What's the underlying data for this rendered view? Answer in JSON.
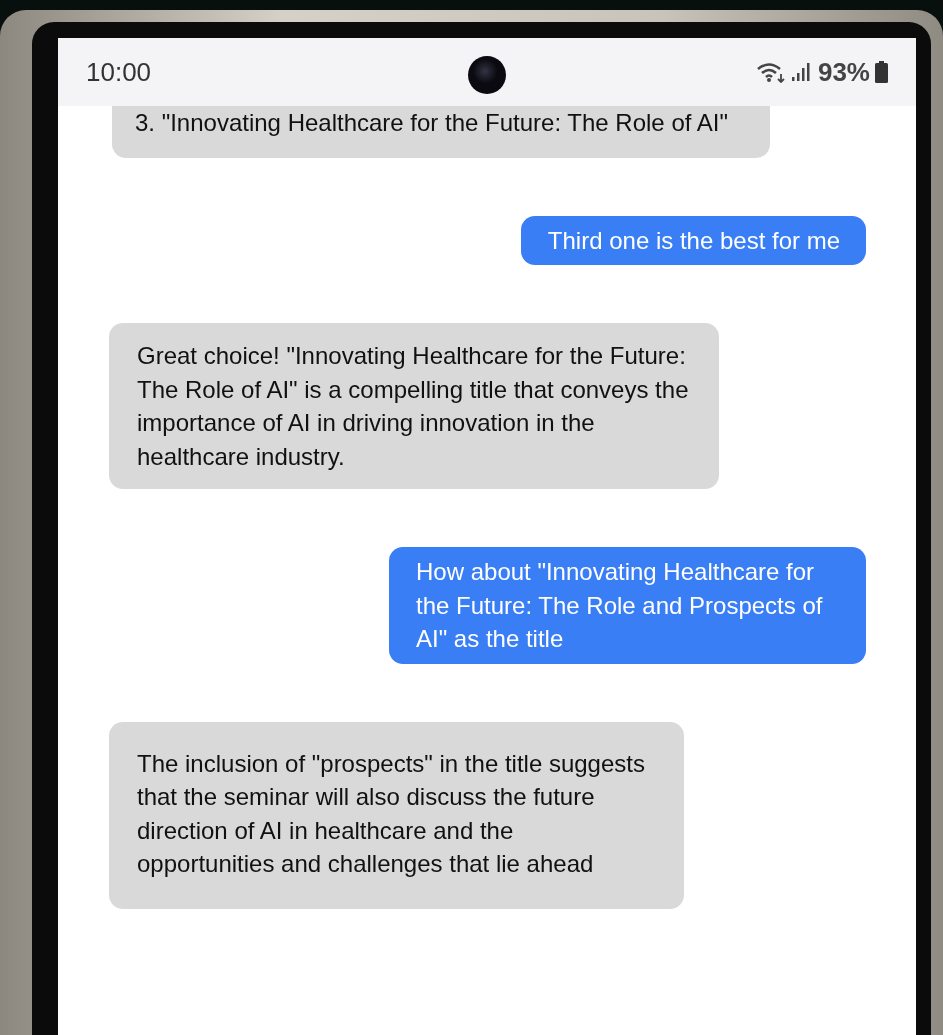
{
  "status_bar": {
    "time": "10:00",
    "battery": "93%"
  },
  "messages": [
    {
      "kind": "received",
      "text": "3. \"Innovating Healthcare for the Future: The Role of AI\""
    },
    {
      "kind": "sent",
      "text": "Third one is the best for me"
    },
    {
      "kind": "received",
      "text": "Great choice! \"Innovating Healthcare for the Future: The Role of AI\" is a compelling title that conveys the importance of AI in driving innovation in the healthcare industry."
    },
    {
      "kind": "sent",
      "text": "How about \"Innovating Healthcare for the Future: The Role and Prospects of AI\" as the title"
    },
    {
      "kind": "received",
      "text": "The inclusion of \"prospects\" in the title suggests that the seminar will also discuss the future direction of AI in healthcare and the opportunities and challenges that lie ahead"
    }
  ]
}
